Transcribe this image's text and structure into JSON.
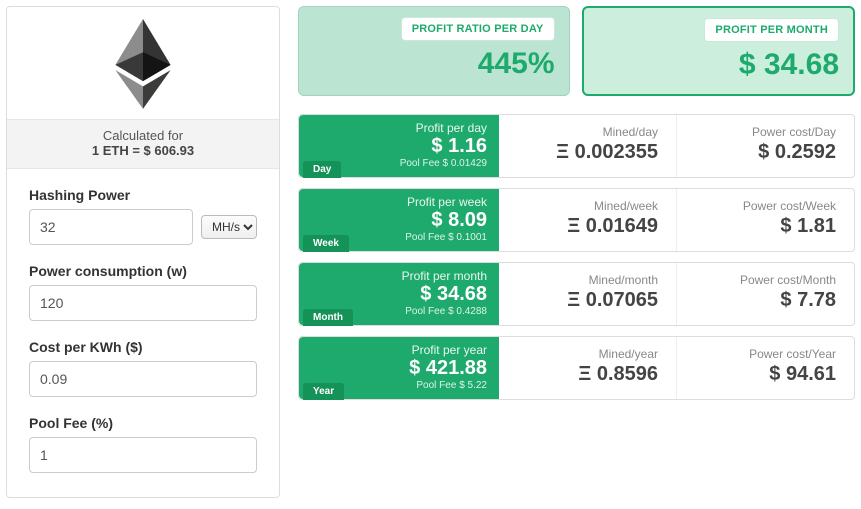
{
  "leftPanel": {
    "calculatedForLabel": "Calculated for",
    "rate": "1 ETH = $ 606.93",
    "fields": {
      "hashingPowerLabel": "Hashing Power",
      "hashingPowerValue": "32",
      "hashingUnit": "MH/s",
      "powerConsumptionLabel": "Power consumption (w)",
      "powerConsumptionValue": "120",
      "costPerKwhLabel": "Cost per KWh ($)",
      "costPerKwhValue": "0.09",
      "poolFeeLabel": "Pool Fee (%)",
      "poolFeeValue": "1"
    }
  },
  "topCards": {
    "ratio": {
      "label": "PROFIT RATIO PER DAY",
      "value": "445%"
    },
    "month": {
      "label": "PROFIT PER MONTH",
      "value": "$ 34.68"
    }
  },
  "rows": {
    "day": {
      "tag": "Day",
      "profitLabel": "Profit per day",
      "profitValue": "$ 1.16",
      "poolFee": "Pool Fee $ 0.01429",
      "minedLabel": "Mined/day",
      "minedValue": "Ξ 0.002355",
      "powerLabel": "Power cost/Day",
      "powerValue": "$ 0.2592"
    },
    "week": {
      "tag": "Week",
      "profitLabel": "Profit per week",
      "profitValue": "$ 8.09",
      "poolFee": "Pool Fee $ 0.1001",
      "minedLabel": "Mined/week",
      "minedValue": "Ξ 0.01649",
      "powerLabel": "Power cost/Week",
      "powerValue": "$ 1.81"
    },
    "month": {
      "tag": "Month",
      "profitLabel": "Profit per month",
      "profitValue": "$ 34.68",
      "poolFee": "Pool Fee $ 0.4288",
      "minedLabel": "Mined/month",
      "minedValue": "Ξ 0.07065",
      "powerLabel": "Power cost/Month",
      "powerValue": "$ 7.78"
    },
    "year": {
      "tag": "Year",
      "profitLabel": "Profit per year",
      "profitValue": "$ 421.88",
      "poolFee": "Pool Fee $ 5.22",
      "minedLabel": "Mined/year",
      "minedValue": "Ξ 0.8596",
      "powerLabel": "Power cost/Year",
      "powerValue": "$ 94.61"
    }
  }
}
